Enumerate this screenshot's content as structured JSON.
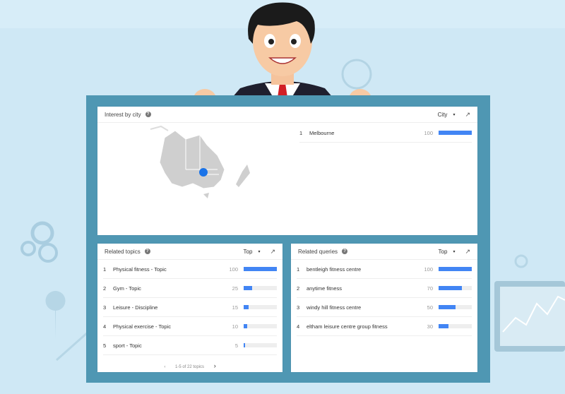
{
  "colors": {
    "accent": "#4285f4",
    "board": "#4f97b3",
    "background": "#cfe8f5"
  },
  "city_panel": {
    "title": "Interest by city",
    "help_icon": "?",
    "selector": "City",
    "caret": "▾",
    "share_icon": "↗",
    "map_marker": "Melbourne",
    "rows": [
      {
        "rank": "1",
        "label": "Melbourne",
        "value": "100",
        "fraction": 1.0
      }
    ]
  },
  "topics_panel": {
    "title": "Related topics",
    "help_icon": "?",
    "selector": "Top",
    "caret": "▾",
    "share_icon": "↗",
    "rows": [
      {
        "rank": "1",
        "label": "Physical fitness - Topic",
        "value": "100",
        "fraction": 1.0
      },
      {
        "rank": "2",
        "label": "Gym - Topic",
        "value": "25",
        "fraction": 0.25
      },
      {
        "rank": "3",
        "label": "Leisure - Discipline",
        "value": "15",
        "fraction": 0.15
      },
      {
        "rank": "4",
        "label": "Physical exercise - Topic",
        "value": "10",
        "fraction": 0.1
      },
      {
        "rank": "5",
        "label": "sport - Topic",
        "value": "5",
        "fraction": 0.05
      }
    ],
    "pager": {
      "prev": "‹",
      "text": "1-5 of 22 topics",
      "next": "›"
    }
  },
  "queries_panel": {
    "title": "Related queries",
    "help_icon": "?",
    "selector": "Top",
    "caret": "▾",
    "share_icon": "↗",
    "rows": [
      {
        "rank": "1",
        "label": "bentleigh fitness centre",
        "value": "100",
        "fraction": 1.0
      },
      {
        "rank": "2",
        "label": "anytime fitness",
        "value": "70",
        "fraction": 0.7
      },
      {
        "rank": "3",
        "label": "windy hill fitness centre",
        "value": "50",
        "fraction": 0.5
      },
      {
        "rank": "4",
        "label": "eltham leisure centre group fitness",
        "value": "30",
        "fraction": 0.3
      }
    ]
  }
}
